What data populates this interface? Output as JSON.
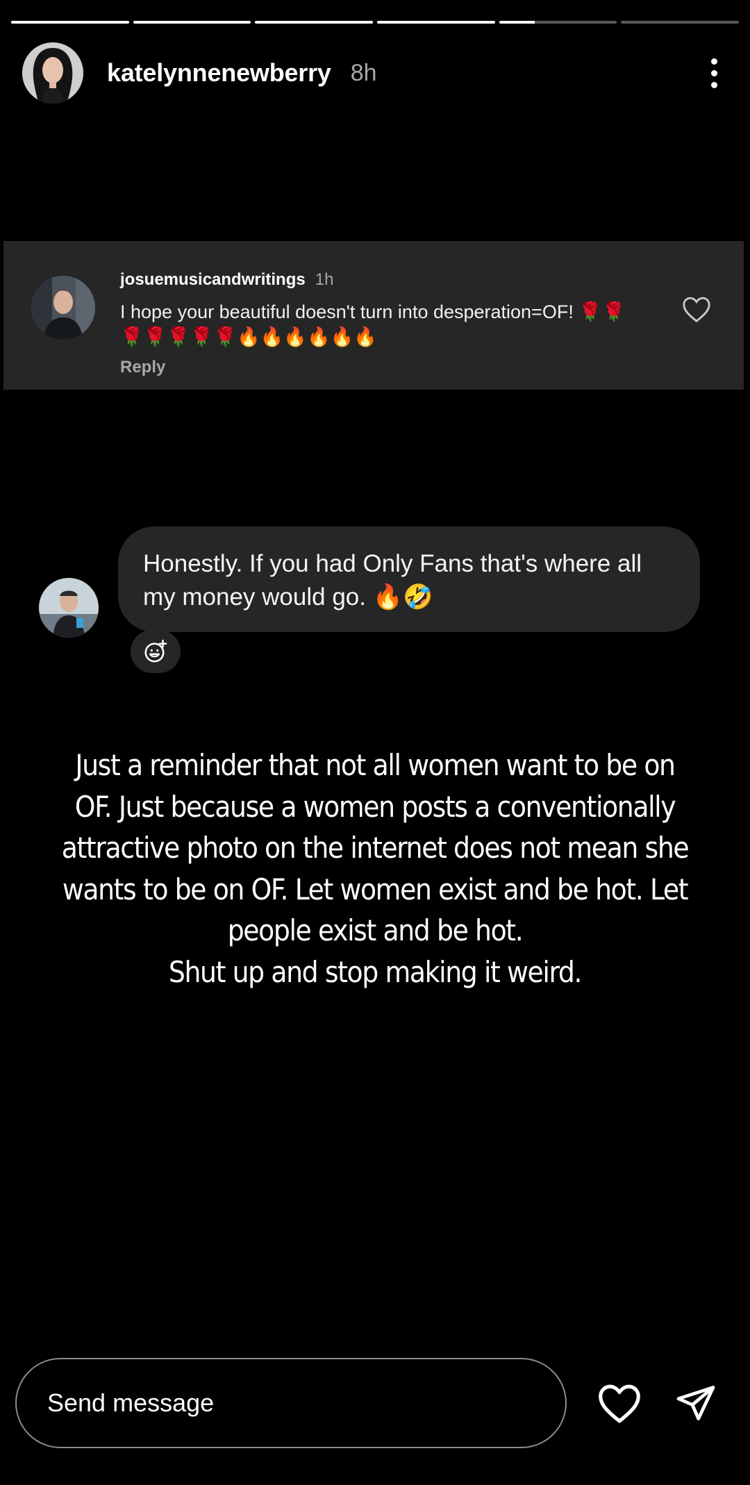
{
  "story": {
    "progress": [
      1,
      1,
      1,
      1,
      0.3,
      0
    ],
    "username": "katelynnenewberry",
    "time": "8h"
  },
  "comment": {
    "username": "josuemusicandwritings",
    "time": "1h",
    "text": "I hope your beautiful doesn't turn into desperation=OF! 🌹🌹🌹🌹🌹🌹🌹🔥🔥🔥🔥🔥🔥",
    "reply_label": "Reply"
  },
  "dm": {
    "text": "Honestly. If you had Only Fans that's where all my money would go. 🔥🤣"
  },
  "caption": {
    "lines": [
      "Just a reminder that not all women want to be on",
      "OF. Just because a women posts a conventionally",
      "attractive photo on the internet does not mean she",
      "wants to be on OF. Let women exist and be hot. Let",
      "people exist and be hot.",
      "Shut up and stop making it weird."
    ]
  },
  "composer": {
    "placeholder": "Send message"
  },
  "icons": {
    "more": "more-vertical-icon",
    "like": "heart-icon",
    "share": "send-paper-plane-icon",
    "react": "add-reaction-icon"
  }
}
